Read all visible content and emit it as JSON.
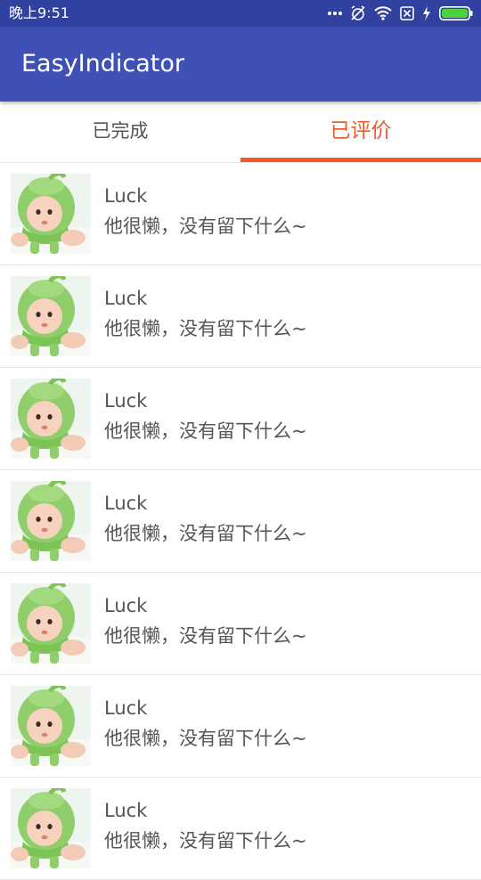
{
  "status_bar": {
    "time": "晚上9:51",
    "icons": [
      "more-dots-icon",
      "alarm-off-icon",
      "wifi-icon",
      "no-sim-icon",
      "charging-bolt-icon",
      "battery-icon"
    ]
  },
  "app_bar": {
    "title": "EasyIndicator",
    "color": "#3f51b5"
  },
  "tabs": [
    {
      "label": "已完成",
      "active": false
    },
    {
      "label": "已评价",
      "active": true
    }
  ],
  "accent_color": "#f05a2b",
  "list": [
    {
      "name": "Luck",
      "desc": "他很懒，没有留下什么~",
      "avatar": "baby-avatar-image"
    },
    {
      "name": "Luck",
      "desc": "他很懒，没有留下什么~",
      "avatar": "baby-avatar-image"
    },
    {
      "name": "Luck",
      "desc": "他很懒，没有留下什么~",
      "avatar": "baby-avatar-image"
    },
    {
      "name": "Luck",
      "desc": "他很懒，没有留下什么~",
      "avatar": "baby-avatar-image"
    },
    {
      "name": "Luck",
      "desc": "他很懒，没有留下什么~",
      "avatar": "baby-avatar-image"
    },
    {
      "name": "Luck",
      "desc": "他很懒，没有留下什么~",
      "avatar": "baby-avatar-image"
    },
    {
      "name": "Luck",
      "desc": "他很懒，没有留下什么~",
      "avatar": "baby-avatar-image"
    }
  ]
}
